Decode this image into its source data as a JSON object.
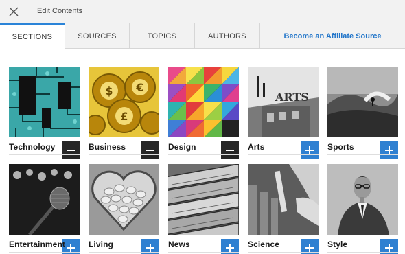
{
  "header": {
    "title": "Edit Contents",
    "close_icon": "close-icon"
  },
  "tabs": [
    {
      "label": "SECTIONS",
      "active": true
    },
    {
      "label": "SOURCES",
      "active": false
    },
    {
      "label": "TOPICS",
      "active": false
    },
    {
      "label": "AUTHORS",
      "active": false
    }
  ],
  "affiliate_link": "Become an Affiliate Source",
  "colors": {
    "accent": "#2f80d1",
    "link": "#2175c9",
    "remove_badge": "#141414"
  },
  "sections": [
    {
      "label": "Technology",
      "state": "remove",
      "icon": "minus-icon",
      "image": "circuit-board"
    },
    {
      "label": "Business",
      "state": "remove",
      "icon": "minus-icon",
      "image": "gears-currency"
    },
    {
      "label": "Design",
      "state": "remove",
      "icon": "minus-icon",
      "image": "color-triangles"
    },
    {
      "label": "Arts",
      "state": "add",
      "icon": "plus-icon",
      "image": "building-sign"
    },
    {
      "label": "Sports",
      "state": "add",
      "icon": "plus-icon",
      "image": "surfer-wave"
    },
    {
      "label": "Entertainment",
      "state": "add",
      "icon": "plus-icon",
      "image": "microphone"
    },
    {
      "label": "Living",
      "state": "add",
      "icon": "plus-icon",
      "image": "heart-pills"
    },
    {
      "label": "News",
      "state": "add",
      "icon": "plus-icon",
      "image": "newspapers"
    },
    {
      "label": "Science",
      "state": "add",
      "icon": "plus-icon",
      "image": "lab-pipette"
    },
    {
      "label": "Style",
      "state": "add",
      "icon": "plus-icon",
      "image": "man-suit"
    }
  ]
}
